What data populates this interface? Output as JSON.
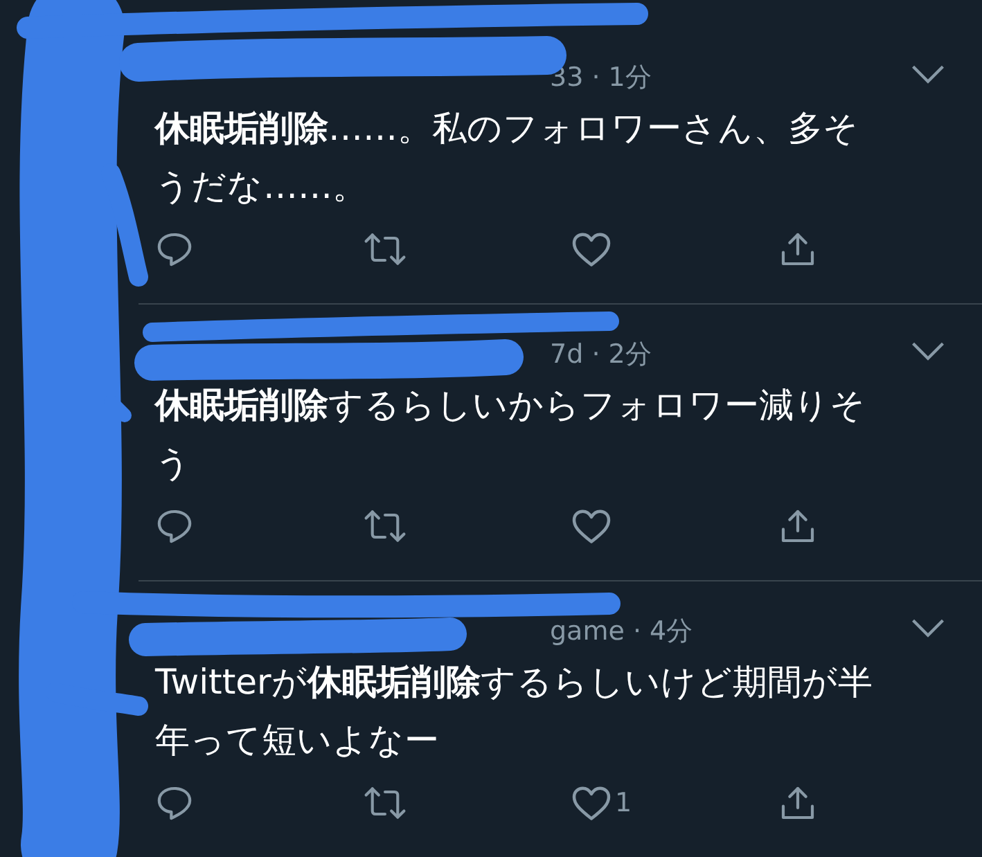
{
  "tweets": [
    {
      "meta": "33 · 1分",
      "text": "**休眠垢削除**……。私のフォロワーさん、多そうだな……。"
    },
    {
      "meta": "7d · 2分",
      "text": "**休眠垢削除**するらしいからフォロワー減りそう"
    },
    {
      "meta": "game · 4分",
      "text": "Twitterが**休眠垢削除**するらしいけど期間が半年って短いよなー",
      "like_count": "1"
    }
  ]
}
